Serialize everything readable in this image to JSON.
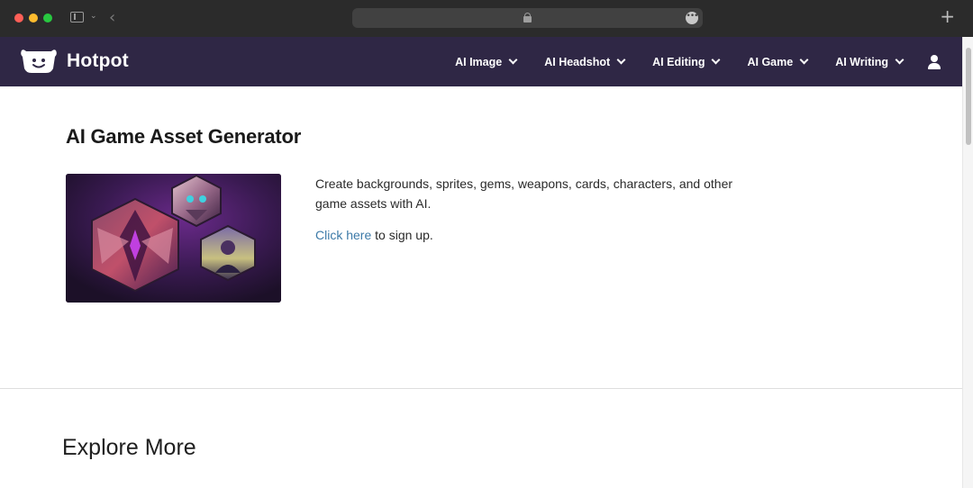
{
  "browser": {
    "icons": [
      "close-icon",
      "minimize-icon",
      "zoom-icon",
      "sidebar-icon",
      "chevron-down-icon",
      "back-arrow-icon",
      "lock-icon",
      "more-icon",
      "plus-icon"
    ]
  },
  "nav": {
    "logo_text": "Hotpot",
    "items": [
      {
        "label": "AI Image"
      },
      {
        "label": "AI Headshot"
      },
      {
        "label": "AI Editing"
      },
      {
        "label": "AI Game"
      },
      {
        "label": "AI Writing"
      }
    ],
    "colors": {
      "background": "#2f2745",
      "text": "#ffffff"
    }
  },
  "main": {
    "title": "AI Game Asset Generator",
    "description": "Create backgrounds, sprites, gems, weapons, cards, characters, and other game assets with AI.",
    "signup_link": "Click here",
    "signup_rest": " to sign up.",
    "link_color": "#3c7aa8"
  },
  "explore": {
    "title": "Explore More"
  }
}
